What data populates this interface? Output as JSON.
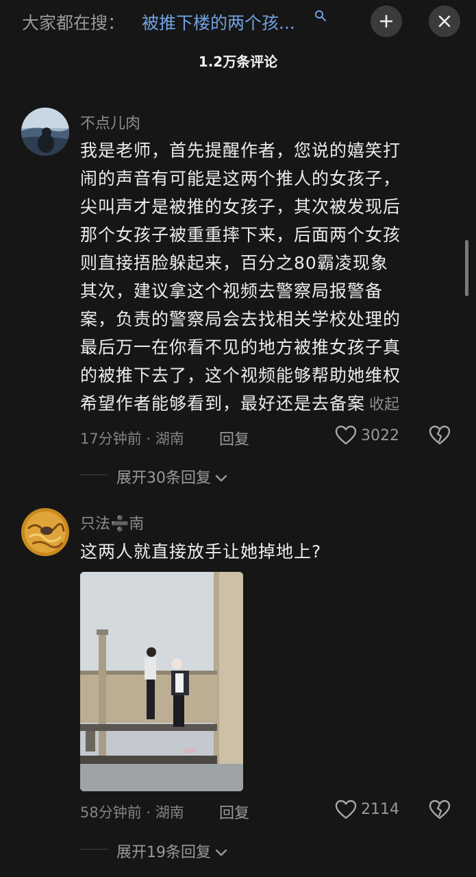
{
  "search": {
    "prefix": "大家都在搜：",
    "query": "被推下楼的两个孩...",
    "icon": "search-icon"
  },
  "header": {
    "title": "1.2万条评论",
    "add_button_icon": "plus-icon",
    "close_button_icon": "close-icon"
  },
  "comments": [
    {
      "username": "不点儿肉",
      "text_lines": [
        "我是老师，首先提醒作者，您说的嬉笑打",
        "闹的声音有可能是这两个推人的女孩子，",
        "尖叫声才是被推的女孩子，其次被发现后",
        "那个女孩子被重重摔下来，后面两个女孩",
        "则直接捂脸躲起来，百分之80霸凌现象",
        "其次，建议拿这个视频去警察局报警备",
        "案，负责的警察局会去找相关学校处理的",
        "最后万一在你看不见的地方被推女孩子真",
        "的被推下去了，这个视频能够帮助她维权",
        "希望作者能够看到，最好还是去备案"
      ],
      "collapse_label": "收起",
      "time_location": "17分钟前 · 湖南",
      "reply_label": "回复",
      "likes": "3022",
      "expand_label": "展开30条回复"
    },
    {
      "username": "只法➗南",
      "text_lines": [
        "这两人就直接放手让她掉地上?"
      ],
      "time_location": "58分钟前 · 湖南",
      "reply_label": "回复",
      "likes": "2114",
      "expand_label": "展开19条回复"
    }
  ],
  "colors": {
    "background": "#161616",
    "link_blue": "#6fa3e3",
    "secondary_text": "#8c8c8c"
  }
}
